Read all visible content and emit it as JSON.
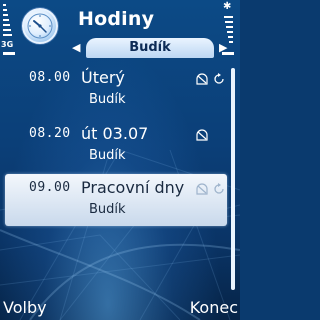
{
  "app": {
    "title": "Hodiny",
    "icon": "clock-icon"
  },
  "tab": {
    "label": "Budík",
    "left_arrow": "◀",
    "right_arrow": "▶"
  },
  "status": {
    "network": "3G",
    "bluetooth": "✱"
  },
  "alarms": [
    {
      "time": "08.00",
      "day": "Úterý",
      "type": "Budík",
      "icons": [
        "alarm-snooze-icon",
        "repeat-icon"
      ]
    },
    {
      "time": "08.20",
      "day": "út 03.07",
      "type": "Budík",
      "icons": [
        "alarm-snooze-icon"
      ]
    },
    {
      "time": "09.00",
      "day": "Pracovní dny",
      "type": "Budík",
      "icons": [
        "alarm-snooze-icon",
        "repeat-icon"
      ],
      "selected": true
    }
  ],
  "softkeys": {
    "left": "Volby",
    "right": "Konec"
  },
  "colors": {
    "background": "#0b3f78",
    "tab": "#d3e6fa",
    "selection": "#e6eef8"
  }
}
